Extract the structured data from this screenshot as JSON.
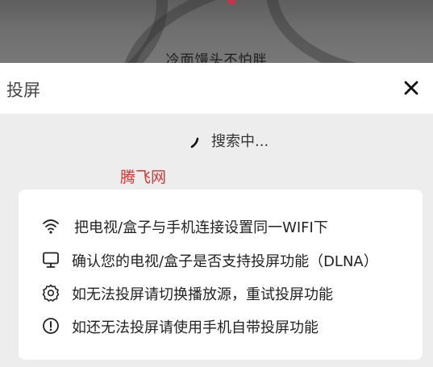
{
  "video": {
    "subtitle": "冷面馒头不怕胖"
  },
  "dialog": {
    "title": "投屏",
    "close_icon": "close-icon"
  },
  "search": {
    "status": "搜索中..."
  },
  "watermark": "腾飞网",
  "tips": [
    {
      "icon": "wifi-icon",
      "text": "把电视/盒子与手机连接设置同一WIFI下"
    },
    {
      "icon": "monitor-icon",
      "text": "确认您的电视/盒子是否支持投屏功能（DLNA）"
    },
    {
      "icon": "gear-icon",
      "text": "如无法投屏请切换播放源，重试投屏功能"
    },
    {
      "icon": "info-icon",
      "text": "如还无法投屏请使用手机自带投屏功能"
    }
  ],
  "colors": {
    "background": "#ededed",
    "card": "#ffffff",
    "watermark": "#e0302d",
    "text": "#222222"
  }
}
